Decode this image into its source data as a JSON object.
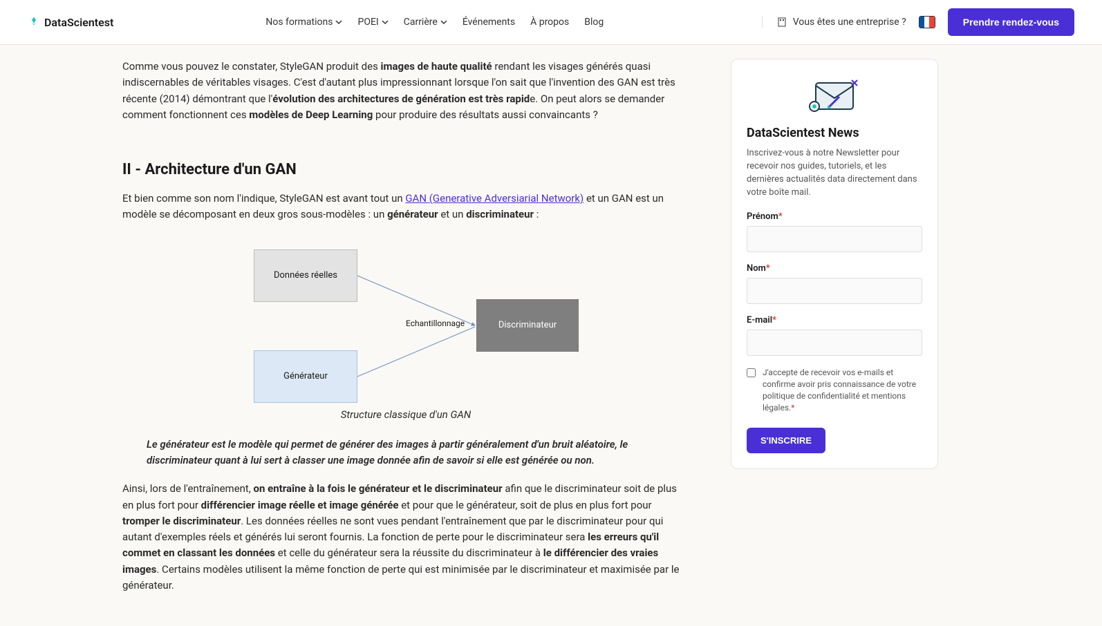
{
  "header": {
    "brand": "DataScientest",
    "nav": {
      "formations": "Nos formations",
      "poei": "POEI",
      "carriere": "Carrière",
      "evenements": "Événements",
      "apropos": "À propos",
      "blog": "Blog"
    },
    "enterprise": "Vous êtes une entreprise ?",
    "cta": "Prendre rendez-vous"
  },
  "article": {
    "p1_a": "Comme vous pouvez le constater, StyleGAN produit des ",
    "p1_b": "images de haute qualité",
    "p1_c": " rendant les visages générés quasi indiscernables de véritables visages. C'est d'autant plus impressionnant lorsque l'on sait que l'invention des GAN est très récente (2014) démontrant que l'",
    "p1_d": "évolution des architectures de génération est très rapid",
    "p1_e": "e. On peut alors se demander comment fonctionnent ces ",
    "p1_f": "modèles de Deep Learning",
    "p1_g": " pour produire des résultats aussi convaincants ?",
    "h2": "II - Architecture d'un GAN",
    "p2_a": "Et bien comme son nom l'indique, StyleGAN est avant tout un ",
    "p2_link": "GAN (Generative Adversiarial Network)",
    "p2_b": " et un GAN est un modèle se décomposant en deux gros sous-modèles : un ",
    "p2_c": "générateur",
    "p2_d": " et un ",
    "p2_e": "discriminateur",
    "p2_f": " :",
    "diagram": {
      "real": "Données réelles",
      "gen": "Générateur",
      "disc": "Discriminateur",
      "sample": "Echantillonnage"
    },
    "caption": "Structure classique d'un GAN",
    "quote": "Le générateur est le modèle qui permet de générer des images à partir généralement d'un bruit aléatoire, le discriminateur quant à lui sert à classer une image donnée afin de savoir si elle est générée ou non.",
    "p3_a": "Ainsi, lors de l'entraînement, ",
    "p3_b": "on entraîne à la fois le générateur et le discriminateur",
    "p3_c": " afin que le discriminateur soit de plus en plus fort pour ",
    "p3_d": "différencier image réelle et image générée",
    "p3_e": " et pour que le générateur, soit de plus en plus fort pour ",
    "p3_f": "tromper le discriminateur",
    "p3_g": ". Les données réelles ne sont vues pendant l'entraînement que par le discriminateur pour qui autant d'exemples réels et générés lui seront fournis. La fonction de perte pour le discriminateur sera ",
    "p3_h": "les erreurs qu'il commet en classant les données",
    "p3_i": " et celle du générateur sera la réussite du discriminateur à ",
    "p3_j": "le différencier des vraies images",
    "p3_k": ". Certains modèles utilisent la même fonction de perte qui est minimisée par le discriminateur et maximisée par le générateur."
  },
  "newsletter": {
    "title": "DataScientest News",
    "desc": "Inscrivez-vous à notre Newsletter pour recevoir nos guides, tutoriels, et les dernières actualités data directement dans votre boîte mail.",
    "prenom": "Prénom",
    "nom": "Nom",
    "email": "E-mail",
    "consent": "J'accepte de recevoir vos e-mails et confirme avoir pris connaissance de votre politique de confidentialité et mentions légales.",
    "submit": "S'INSCRIRE"
  }
}
